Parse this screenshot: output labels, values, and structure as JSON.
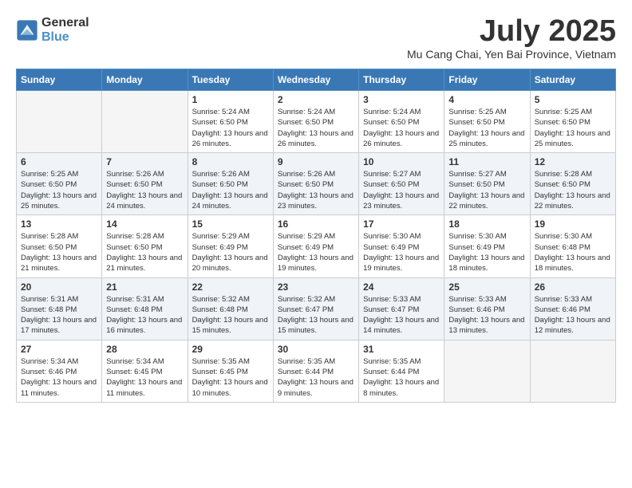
{
  "header": {
    "logo_line1": "General",
    "logo_line2": "Blue",
    "month": "July 2025",
    "location": "Mu Cang Chai, Yen Bai Province, Vietnam"
  },
  "days_of_week": [
    "Sunday",
    "Monday",
    "Tuesday",
    "Wednesday",
    "Thursday",
    "Friday",
    "Saturday"
  ],
  "weeks": [
    [
      {
        "day": "",
        "empty": true
      },
      {
        "day": "",
        "empty": true
      },
      {
        "day": "1",
        "sunrise": "5:24 AM",
        "sunset": "6:50 PM",
        "daylight": "13 hours and 26 minutes."
      },
      {
        "day": "2",
        "sunrise": "5:24 AM",
        "sunset": "6:50 PM",
        "daylight": "13 hours and 26 minutes."
      },
      {
        "day": "3",
        "sunrise": "5:24 AM",
        "sunset": "6:50 PM",
        "daylight": "13 hours and 26 minutes."
      },
      {
        "day": "4",
        "sunrise": "5:25 AM",
        "sunset": "6:50 PM",
        "daylight": "13 hours and 25 minutes."
      },
      {
        "day": "5",
        "sunrise": "5:25 AM",
        "sunset": "6:50 PM",
        "daylight": "13 hours and 25 minutes."
      }
    ],
    [
      {
        "day": "6",
        "sunrise": "5:25 AM",
        "sunset": "6:50 PM",
        "daylight": "13 hours and 25 minutes."
      },
      {
        "day": "7",
        "sunrise": "5:26 AM",
        "sunset": "6:50 PM",
        "daylight": "13 hours and 24 minutes."
      },
      {
        "day": "8",
        "sunrise": "5:26 AM",
        "sunset": "6:50 PM",
        "daylight": "13 hours and 24 minutes."
      },
      {
        "day": "9",
        "sunrise": "5:26 AM",
        "sunset": "6:50 PM",
        "daylight": "13 hours and 23 minutes."
      },
      {
        "day": "10",
        "sunrise": "5:27 AM",
        "sunset": "6:50 PM",
        "daylight": "13 hours and 23 minutes."
      },
      {
        "day": "11",
        "sunrise": "5:27 AM",
        "sunset": "6:50 PM",
        "daylight": "13 hours and 22 minutes."
      },
      {
        "day": "12",
        "sunrise": "5:28 AM",
        "sunset": "6:50 PM",
        "daylight": "13 hours and 22 minutes."
      }
    ],
    [
      {
        "day": "13",
        "sunrise": "5:28 AM",
        "sunset": "6:50 PM",
        "daylight": "13 hours and 21 minutes."
      },
      {
        "day": "14",
        "sunrise": "5:28 AM",
        "sunset": "6:50 PM",
        "daylight": "13 hours and 21 minutes."
      },
      {
        "day": "15",
        "sunrise": "5:29 AM",
        "sunset": "6:49 PM",
        "daylight": "13 hours and 20 minutes."
      },
      {
        "day": "16",
        "sunrise": "5:29 AM",
        "sunset": "6:49 PM",
        "daylight": "13 hours and 19 minutes."
      },
      {
        "day": "17",
        "sunrise": "5:30 AM",
        "sunset": "6:49 PM",
        "daylight": "13 hours and 19 minutes."
      },
      {
        "day": "18",
        "sunrise": "5:30 AM",
        "sunset": "6:49 PM",
        "daylight": "13 hours and 18 minutes."
      },
      {
        "day": "19",
        "sunrise": "5:30 AM",
        "sunset": "6:48 PM",
        "daylight": "13 hours and 18 minutes."
      }
    ],
    [
      {
        "day": "20",
        "sunrise": "5:31 AM",
        "sunset": "6:48 PM",
        "daylight": "13 hours and 17 minutes."
      },
      {
        "day": "21",
        "sunrise": "5:31 AM",
        "sunset": "6:48 PM",
        "daylight": "13 hours and 16 minutes."
      },
      {
        "day": "22",
        "sunrise": "5:32 AM",
        "sunset": "6:48 PM",
        "daylight": "13 hours and 15 minutes."
      },
      {
        "day": "23",
        "sunrise": "5:32 AM",
        "sunset": "6:47 PM",
        "daylight": "13 hours and 15 minutes."
      },
      {
        "day": "24",
        "sunrise": "5:33 AM",
        "sunset": "6:47 PM",
        "daylight": "13 hours and 14 minutes."
      },
      {
        "day": "25",
        "sunrise": "5:33 AM",
        "sunset": "6:46 PM",
        "daylight": "13 hours and 13 minutes."
      },
      {
        "day": "26",
        "sunrise": "5:33 AM",
        "sunset": "6:46 PM",
        "daylight": "13 hours and 12 minutes."
      }
    ],
    [
      {
        "day": "27",
        "sunrise": "5:34 AM",
        "sunset": "6:46 PM",
        "daylight": "13 hours and 11 minutes."
      },
      {
        "day": "28",
        "sunrise": "5:34 AM",
        "sunset": "6:45 PM",
        "daylight": "13 hours and 11 minutes."
      },
      {
        "day": "29",
        "sunrise": "5:35 AM",
        "sunset": "6:45 PM",
        "daylight": "13 hours and 10 minutes."
      },
      {
        "day": "30",
        "sunrise": "5:35 AM",
        "sunset": "6:44 PM",
        "daylight": "13 hours and 9 minutes."
      },
      {
        "day": "31",
        "sunrise": "5:35 AM",
        "sunset": "6:44 PM",
        "daylight": "13 hours and 8 minutes."
      },
      {
        "day": "",
        "empty": true
      },
      {
        "day": "",
        "empty": true
      }
    ]
  ]
}
